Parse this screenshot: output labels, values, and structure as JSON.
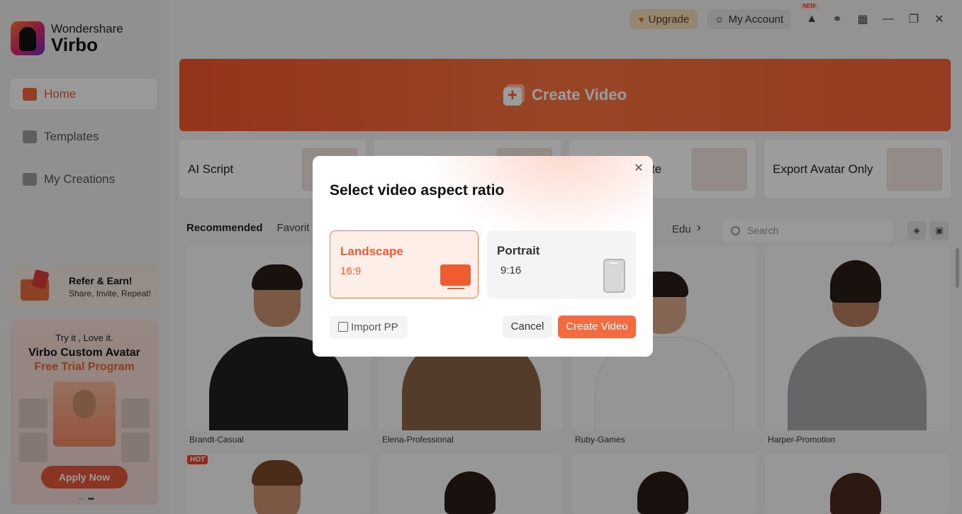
{
  "app": {
    "brand_line1": "Wondershare",
    "brand_line2": "Virbo"
  },
  "topbar": {
    "upgrade_label": "Upgrade",
    "account_label": "My Account",
    "new_badge": "NEW"
  },
  "sidebar": {
    "items": [
      {
        "label": "Home",
        "icon": "home-icon",
        "active": true
      },
      {
        "label": "Templates",
        "icon": "templates-icon",
        "active": false
      },
      {
        "label": "My Creations",
        "icon": "creations-icon",
        "active": false
      }
    ],
    "refer": {
      "title": "Refer & Earn!",
      "subtitle": "Share, Invite, Repeat!"
    },
    "promo": {
      "line1": "Try it , Love it.",
      "line2": "Virbo Custom Avatar",
      "line3": "Free Trial Program",
      "button": "Apply Now"
    }
  },
  "main": {
    "banner_label": "Create Video",
    "cards": [
      {
        "label": "AI Script"
      },
      {
        "label": ""
      },
      {
        "label": "te"
      },
      {
        "label": "Export Avatar Only"
      }
    ],
    "tabs": [
      "Recommended",
      "Favorit"
    ],
    "tab_partial_right": "Edu",
    "search_placeholder": "Search",
    "avatars": [
      {
        "name": "Brandt-Casual"
      },
      {
        "name": "Elena-Professional"
      },
      {
        "name": "Ruby-Games"
      },
      {
        "name": "Harper-Promotion"
      }
    ],
    "hot_badge": "HOT"
  },
  "dialog": {
    "title": "Select video aspect ratio",
    "options": [
      {
        "name": "Landscape",
        "ratio": "16:9",
        "selected": true
      },
      {
        "name": "Portrait",
        "ratio": "9:16",
        "selected": false
      }
    ],
    "import_label": "Import PP",
    "cancel_label": "Cancel",
    "create_label": "Create Video"
  },
  "colors": {
    "accent": "#F36B3F",
    "brand_orange": "#F15A30",
    "upgrade_bg": "#F3DCB8"
  }
}
